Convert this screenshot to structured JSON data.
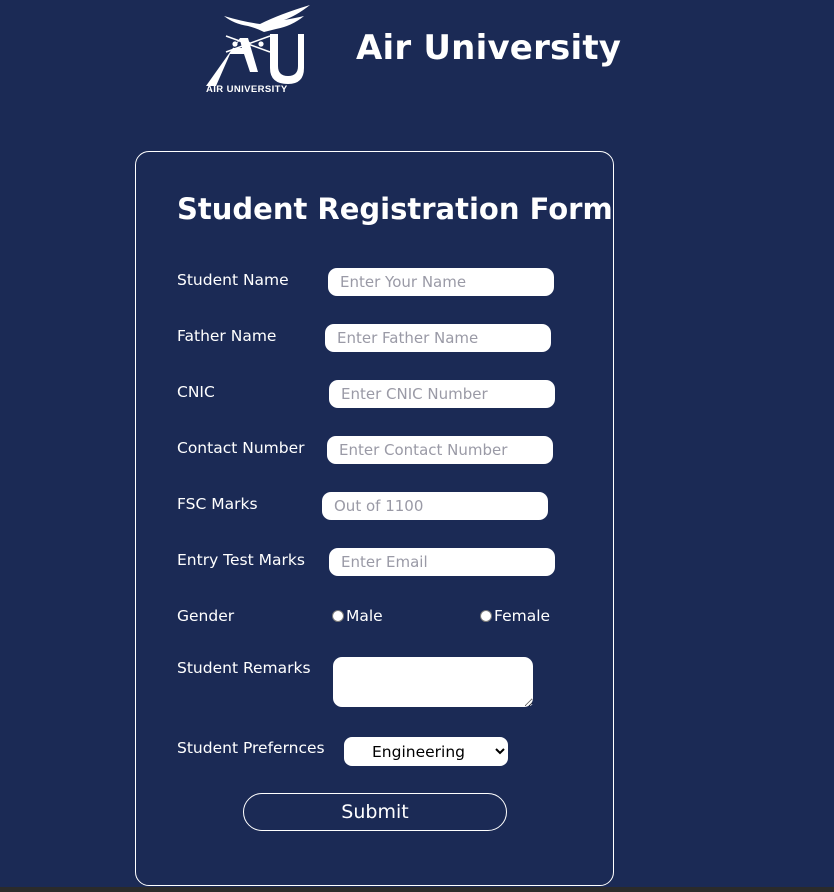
{
  "header": {
    "logo_text": "AIR UNIVERSITY",
    "title": "Air University"
  },
  "form": {
    "title": "Student Registration Form",
    "fields": {
      "student_name": {
        "label": "Student Name",
        "placeholder": "Enter Your Name",
        "value": ""
      },
      "father_name": {
        "label": "Father Name",
        "placeholder": "Enter Father Name",
        "value": ""
      },
      "cnic": {
        "label": "CNIC",
        "placeholder": "Enter CNIC Number",
        "value": ""
      },
      "contact": {
        "label": "Contact Number",
        "placeholder": "Enter Contact Number",
        "value": ""
      },
      "fsc": {
        "label": "FSC Marks",
        "placeholder": "Out of 1100",
        "value": ""
      },
      "entry_test": {
        "label": "Entry Test Marks",
        "placeholder": "Enter Email",
        "value": ""
      }
    },
    "gender": {
      "label": "Gender",
      "options": [
        "Male",
        "Female"
      ]
    },
    "remarks": {
      "label": "Student Remarks",
      "value": ""
    },
    "preferences": {
      "label": "Student Prefernces",
      "selected": "Engineering"
    },
    "submit_label": "Submit"
  },
  "colors": {
    "background": "#1b2a55",
    "foreground": "#ffffff"
  }
}
